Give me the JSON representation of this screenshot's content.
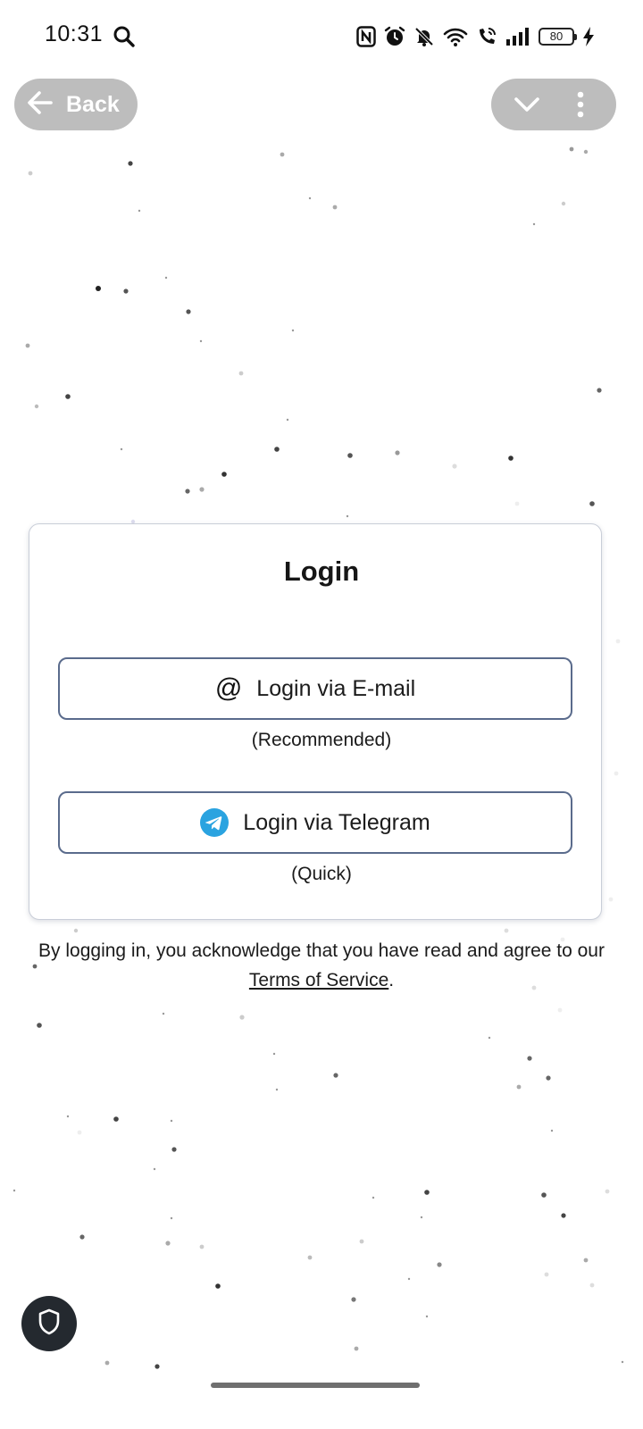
{
  "status_bar": {
    "time": "10:31",
    "battery_level": "80",
    "icons": [
      "search-icon",
      "nfc-icon",
      "alarm-icon",
      "bell-off-icon",
      "wifi-icon",
      "wifi-call-icon",
      "signal-icon",
      "battery-icon",
      "charging-icon"
    ]
  },
  "nav": {
    "back_label": "Back",
    "back_icon": "arrow-left-icon",
    "collapse_icon": "chevron-down-icon",
    "menu_icon": "more-vertical-icon"
  },
  "login": {
    "title": "Login",
    "email_button_label": "Login via E-mail",
    "email_icon_glyph": "@",
    "email_hint": "(Recommended)",
    "telegram_button_label": "Login via Telegram",
    "telegram_icon": "telegram-icon",
    "telegram_hint": "(Quick)"
  },
  "terms": {
    "prefix": "By logging in, you acknowledge that you have read and agree to our ",
    "link_text": "Terms of Service",
    "suffix": "."
  },
  "fab": {
    "icon": "shield-icon"
  },
  "colors": {
    "background": "#ffffff",
    "pill_background": "#bdbdbd",
    "button_border": "#5a6b8c",
    "telegram_blue": "#2aa3e0",
    "fab_background": "#24292f"
  }
}
